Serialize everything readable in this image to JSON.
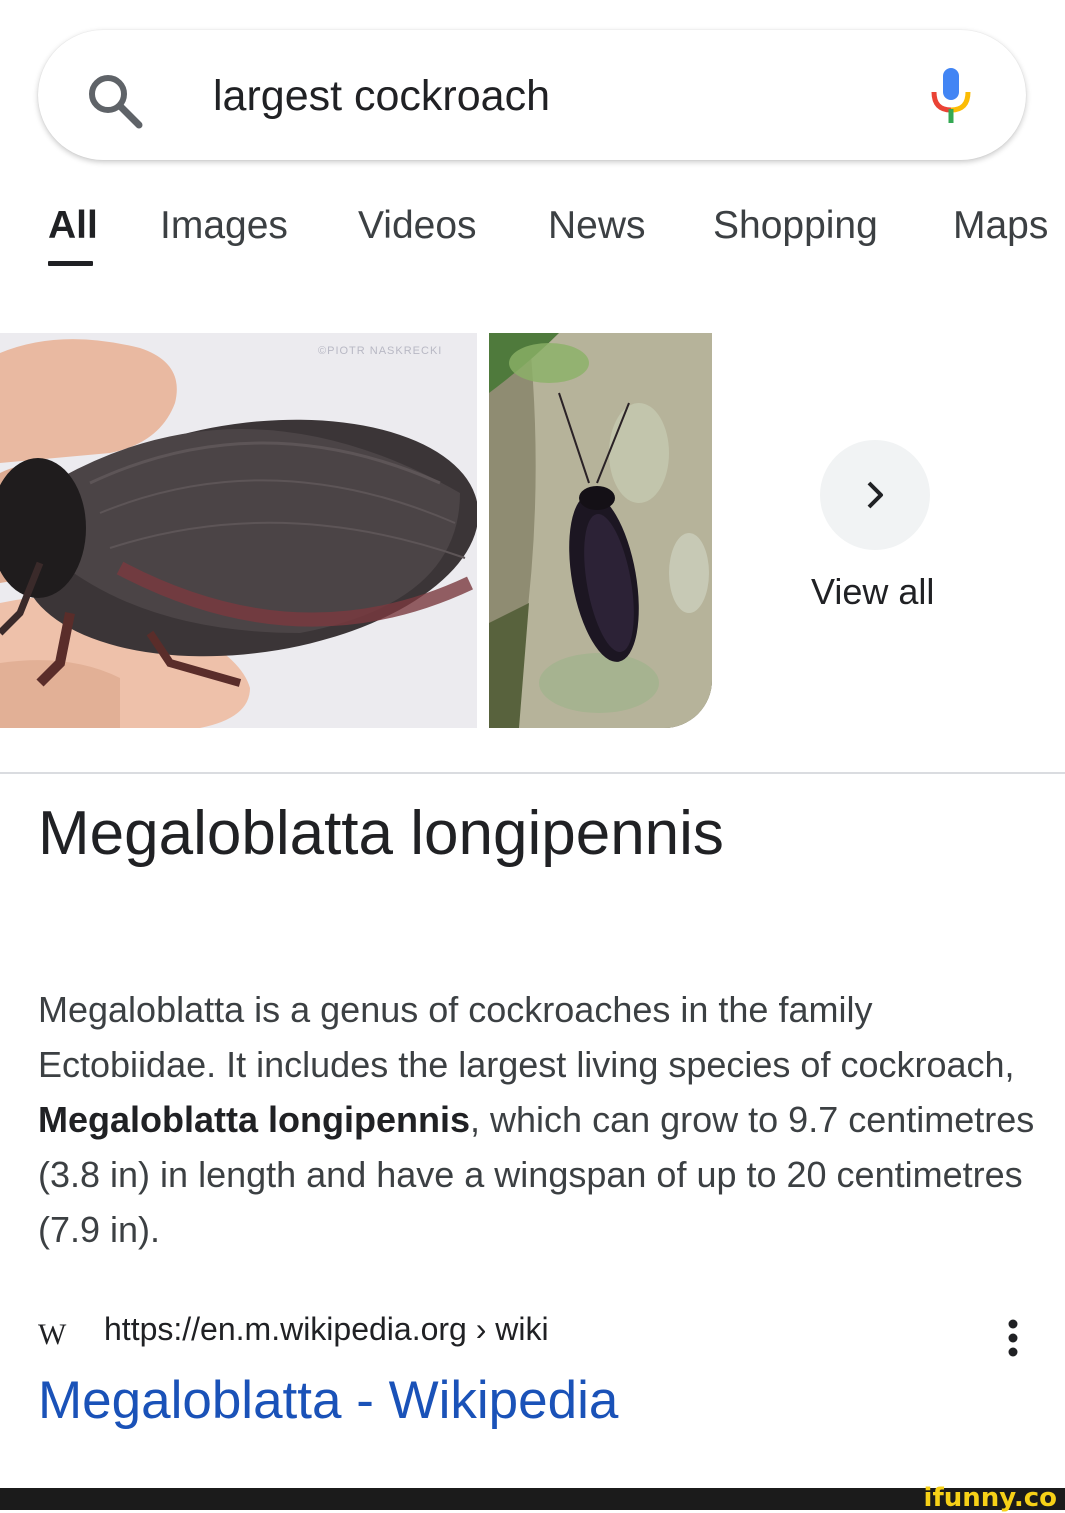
{
  "search": {
    "query": "largest cockroach"
  },
  "tabs": [
    {
      "label": "All",
      "active": true
    },
    {
      "label": "Images",
      "active": false
    },
    {
      "label": "Videos",
      "active": false
    },
    {
      "label": "News",
      "active": false
    },
    {
      "label": "Shopping",
      "active": false
    },
    {
      "label": "Maps",
      "active": false
    }
  ],
  "images": {
    "watermark": "©PIOTR NASKRECKI",
    "view_all_label": "View all"
  },
  "knowledge_panel": {
    "title": "Megaloblatta longipennis",
    "desc_part1": "Megaloblatta is a genus of cockroaches in the family Ectobiidae. It includes the largest living species of cockroach, ",
    "desc_bold": "Megaloblatta longipennis",
    "desc_part2": ", which can grow to 9.7 centimetres (3.8 in) in length and have a wingspan of up to 20 centimetres (7.9 in)."
  },
  "result": {
    "source_logo": "W",
    "url": "https://en.m.wikipedia.org › wiki",
    "title": "Megaloblatta - Wikipedia"
  },
  "watermark_brand": "ifunny.co",
  "colors": {
    "link": "#1a52b8",
    "mic_blue": "#4285f4",
    "mic_red": "#ea4335",
    "mic_yellow": "#fbbc05",
    "mic_green": "#34a853"
  }
}
